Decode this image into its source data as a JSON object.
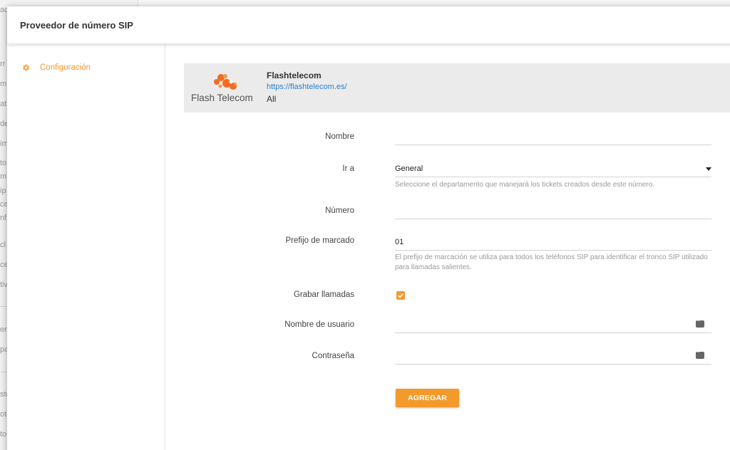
{
  "background": {
    "left_fragments": [
      "ac",
      "rr",
      "m",
      "at",
      "de",
      "im",
      "to",
      "m",
      "ip",
      "ce",
      "nf",
      "cl",
      "ce",
      "tiv",
      "er",
      "pa",
      "ste",
      "ote",
      "to"
    ]
  },
  "modal": {
    "title": "Proveedor de número SIP",
    "sidebar": {
      "items": [
        {
          "label": "Configuración",
          "icon": "gear-icon",
          "active": true
        }
      ]
    },
    "provider": {
      "logo_text": "Flash Telecom",
      "name": "Flashtelecom",
      "url": "https://flashtelecom.es/",
      "scope": "All"
    },
    "form": {
      "nombre": {
        "label": "Nombre",
        "value": ""
      },
      "ir_a": {
        "label": "Ir a",
        "value": "General",
        "hint": "Seleccione el departamento que manejará los tickets creados desde este número."
      },
      "numero": {
        "label": "Número",
        "value": ""
      },
      "prefijo": {
        "label": "Prefijo de marcado",
        "value": "01",
        "hint": "El prefijo de marcación se utiliza para todos los teléfonos SIP para identificar el tronco SIP utilizado para llamadas salientes."
      },
      "grabar": {
        "label": "Grabar llamadas",
        "checked": true
      },
      "usuario": {
        "label": "Nombre de usuario",
        "value": ""
      },
      "contrasena": {
        "label": "Contraseña",
        "value": ""
      },
      "submit_label": "AGREGAR"
    },
    "accent_color": "#f39a2b"
  }
}
